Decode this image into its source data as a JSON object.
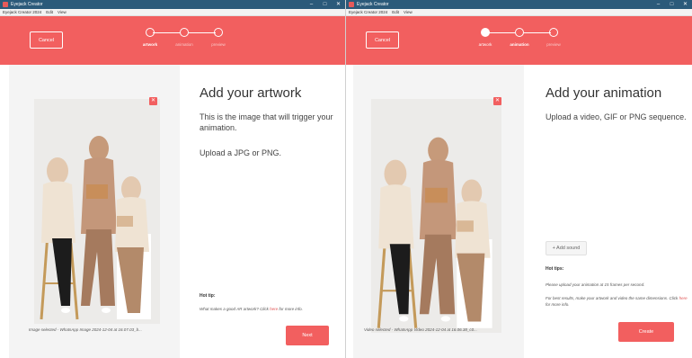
{
  "left_window": {
    "title": "Eyejack Creator",
    "menu": [
      "Eyejack Creator 2024",
      "Edit",
      "View"
    ],
    "controls": {
      "minimize": "–",
      "maximize": "□",
      "close": "✕"
    },
    "cancel_label": "Cancel",
    "steps": [
      {
        "label": "artwork",
        "state": "active"
      },
      {
        "label": "animation",
        "state": "upcoming"
      },
      {
        "label": "preview",
        "state": "upcoming"
      }
    ],
    "heading": "Add your artwork",
    "description": "This is the image that will trigger your animation.",
    "instruction": "Upload a JPG or PNG.",
    "image_caption": "Image selected - WhatsApp Image 2024-12-04 at 16.07.03_b...",
    "remove_icon": "✕",
    "hot_tip_title": "Hot tip:",
    "hot_tip_before": "What makes a good AR artwork? Click ",
    "hot_tip_link": "here",
    "hot_tip_after": " for more info.",
    "next_label": "Next"
  },
  "right_window": {
    "title": "Eyejack Creator",
    "menu": [
      "Eyejack Creator 2024",
      "Edit",
      "View"
    ],
    "controls": {
      "minimize": "–",
      "maximize": "□",
      "close": "✕"
    },
    "cancel_label": "Cancel",
    "steps": [
      {
        "label": "artwork",
        "state": "done"
      },
      {
        "label": "animation",
        "state": "active"
      },
      {
        "label": "preview",
        "state": "upcoming"
      }
    ],
    "heading": "Add your animation",
    "description": "Upload a video, GIF or PNG sequence.",
    "video_caption": "Video selected - WhatsApp Video 2024-12-04 at 16.06.38_c0...",
    "remove_icon": "✕",
    "add_sound_label": "+ Add sound",
    "hot_tips_title": "Hot tips:",
    "tip_1": "Please upload your animation at 15 frames per second.",
    "tip_2_before": "For best results, make your artwork and video the same dimensions. Click ",
    "tip_2_link": "here",
    "tip_2_after": " for more info.",
    "create_label": "Create"
  },
  "colors": {
    "accent": "#f25f5f",
    "titlebar": "#2b5a7a"
  }
}
